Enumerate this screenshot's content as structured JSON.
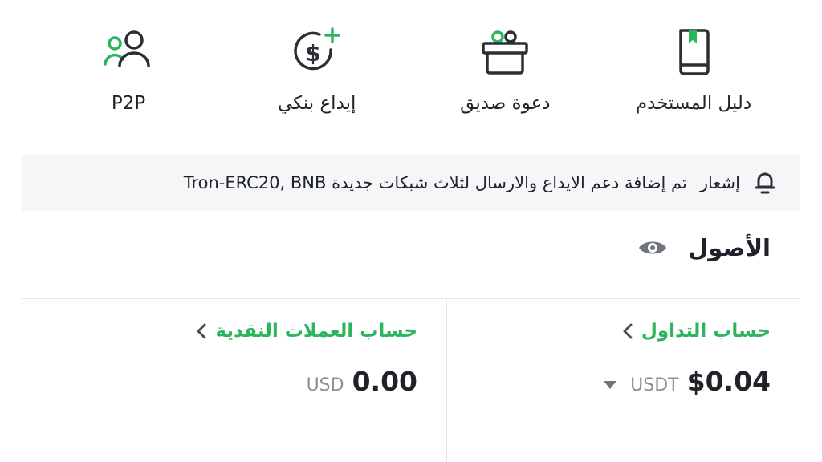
{
  "shortcuts": [
    {
      "label": "دليل المستخدم",
      "icon": "user-guide-book-icon"
    },
    {
      "label": "دعوة صديق",
      "icon": "gift-icon"
    },
    {
      "label": "إيداع بنكي",
      "icon": "dollar-plus-icon"
    },
    {
      "label": "P2P",
      "icon": "p2p-users-icon"
    }
  ],
  "notice": {
    "tag": "إشعار",
    "message": "تم إضافة دعم الايداع والارسال لثلاث شبكات جديدة  Tron-ERC20, BNB",
    "icon": "bell-icon"
  },
  "assets": {
    "title": "الأصول",
    "visibility_icon": "eye-icon"
  },
  "accounts": {
    "trading": {
      "name": "حساب التداول",
      "amount": "$0.04",
      "unit": "USDT"
    },
    "fiat": {
      "name": "حساب العملات النقدية",
      "amount": "0.00",
      "unit": "USD"
    }
  },
  "colors": {
    "accent": "#2db55d",
    "text": "#1f2329",
    "muted": "#8a9099",
    "notice_bg": "#f5f6f7"
  }
}
